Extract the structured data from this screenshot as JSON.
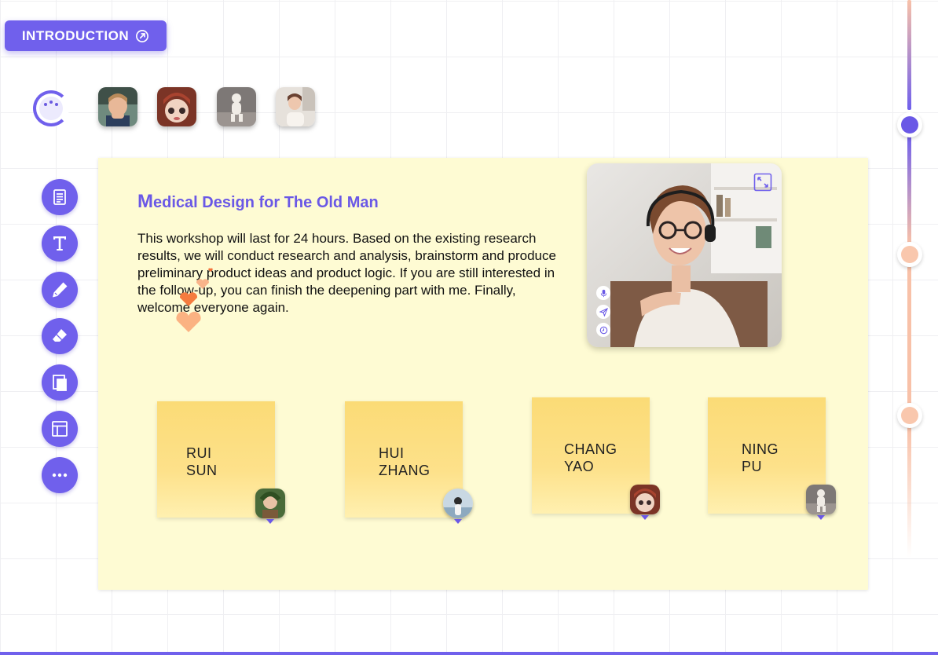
{
  "intro_button": {
    "label": "INTRODUCTION",
    "icon": "external-link-icon"
  },
  "participants": [
    {
      "name": "child-portrait",
      "colors": [
        "#cfa57d",
        "#5b3a2a"
      ]
    },
    {
      "name": "character-portrait",
      "colors": [
        "#8a3a2a",
        "#e8c8b4"
      ]
    },
    {
      "name": "runner-portrait",
      "colors": [
        "#8d8988",
        "#e7e2dc"
      ]
    },
    {
      "name": "woman-portrait",
      "colors": [
        "#ddd6cf",
        "#5a4036"
      ]
    }
  ],
  "toolbar": [
    {
      "id": "document",
      "icon": "document-icon"
    },
    {
      "id": "text",
      "icon": "text-icon"
    },
    {
      "id": "pen",
      "icon": "pen-icon"
    },
    {
      "id": "eraser",
      "icon": "eraser-icon"
    },
    {
      "id": "copy",
      "icon": "copy-icon"
    },
    {
      "id": "layout",
      "icon": "layout-icon"
    },
    {
      "id": "more",
      "icon": "more-icon"
    }
  ],
  "board": {
    "title_first": "M",
    "title_rest": "edical Design for The Old Man",
    "body": "This workshop will last for 24 hours. Based on the existing research results, we will conduct research and analysis, brainstorm and produce preliminary product ideas and product logic. If you are still interested in the follow-up, you can finish the deepening part with me. Finally, welcome everyone again."
  },
  "video": {
    "controls": [
      "microphone-icon",
      "send-icon",
      "clock-icon"
    ],
    "expand_icon": "expand-icon"
  },
  "notes": [
    {
      "first": "RUI",
      "last": "SUN"
    },
    {
      "first": "HUI",
      "last": "ZHANG"
    },
    {
      "first": "CHANG",
      "last": "YAO"
    },
    {
      "first": "NING",
      "last": "PU"
    }
  ],
  "colors": {
    "accent": "#7060ec",
    "board": "#fefbd3",
    "note": "#fde18a",
    "timeline_peach": "#f8c1a8"
  }
}
